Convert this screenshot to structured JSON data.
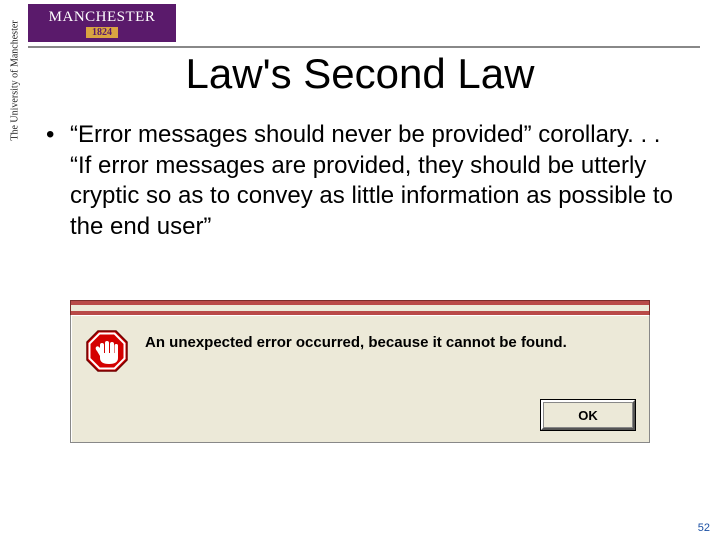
{
  "brand": {
    "name": "MANCHESTER",
    "year": "1824",
    "sidebar": "The University of Manchester"
  },
  "title": "Law's Second Law",
  "bullet": "“Error messages should never be provided” corollary. . . “If error messages are provided, they should be utterly cryptic so as to convey as little information as possible to the end user”",
  "dialog": {
    "icon_name": "stop-hand-icon",
    "message": "An unexpected error occurred, because it cannot be found.",
    "ok_label": "OK"
  },
  "page_number": "52"
}
